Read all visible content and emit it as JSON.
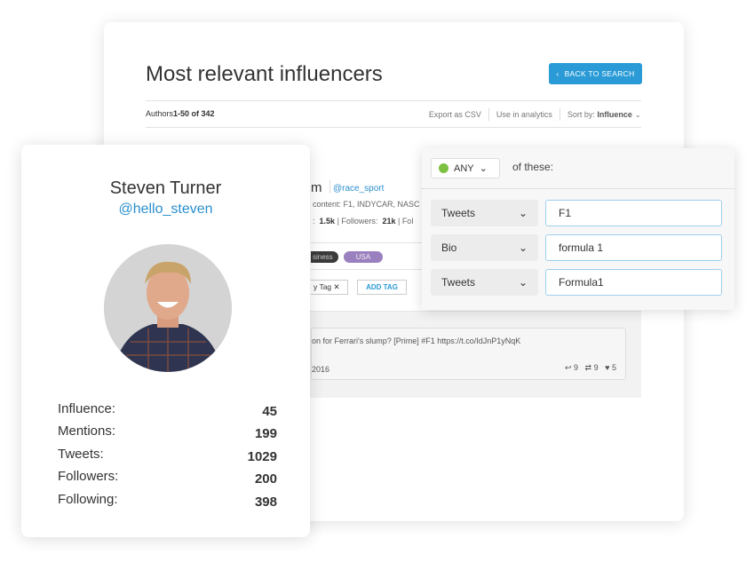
{
  "header": {
    "title": "Most relevant influencers",
    "back_label": "BACK TO SEARCH"
  },
  "toolbar": {
    "authors_prefix": "Authors",
    "authors_range": "1-50 of 342",
    "export": "Export as CSV",
    "analytics": "Use in analytics",
    "sort_prefix": "Sort by:",
    "sort_value": "Influence"
  },
  "result": {
    "name_fragment": "m",
    "handle": "@race_sport",
    "content": "content: F1, INDYCAR, NASC",
    "stat_prefix": ":",
    "stat1": "1.5k",
    "followers_label": "Followers:",
    "followers": "21k",
    "following_fragment": "Fol",
    "tag1": "siness",
    "tag2": "USA",
    "my_tag": "y Tag",
    "add_tag": "ADD TAG",
    "tweet_text": "on for Ferrari's slump? [Prime] #F1 https://t.co/IdJnP1yNqK",
    "tweet_date": "2016",
    "replies": "9",
    "retweets": "9",
    "likes": "5"
  },
  "profile": {
    "name": "Steven Turner",
    "handle": "@hello_steven",
    "stats": [
      {
        "label": "Influence:",
        "value": "45"
      },
      {
        "label": "Mentions:",
        "value": "199"
      },
      {
        "label": "Tweets:",
        "value": "1029"
      },
      {
        "label": "Followers:",
        "value": "200"
      },
      {
        "label": "Following:",
        "value": "398"
      }
    ]
  },
  "filter": {
    "mode": "ANY",
    "mode_color": "#7cc142",
    "suffix": "of these:",
    "rows": [
      {
        "field": "Tweets",
        "value": "F1"
      },
      {
        "field": "Bio",
        "value": "formula 1"
      },
      {
        "field": "Tweets",
        "value": "Formula1"
      }
    ]
  },
  "colors": {
    "accent": "#2a9bd6",
    "tag_dark": "#3a3a3a",
    "tag_purple": "#9b80c0"
  }
}
